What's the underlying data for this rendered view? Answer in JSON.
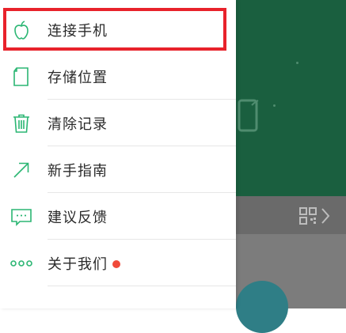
{
  "colors": {
    "accent_green": "#2bb673",
    "highlight_red": "#e8222b",
    "badge_red": "#f04a3a"
  },
  "menu": {
    "items": [
      {
        "label": "连接手机",
        "icon": "apple-icon"
      },
      {
        "label": "存储位置",
        "icon": "file-icon"
      },
      {
        "label": "清除记录",
        "icon": "trash-icon"
      },
      {
        "label": "新手指南",
        "icon": "arrow-up-right-icon"
      },
      {
        "label": "建议反馈",
        "icon": "message-icon"
      },
      {
        "label": "关于我们",
        "icon": "more-dots-icon"
      }
    ]
  }
}
